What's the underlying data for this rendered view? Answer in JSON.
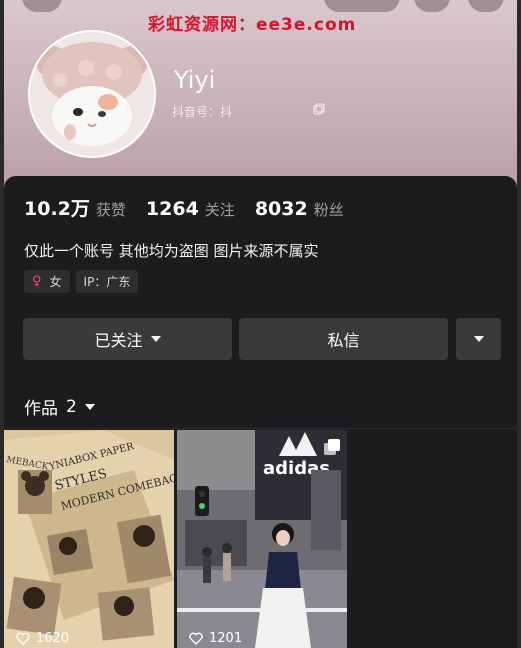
{
  "watermark": "彩虹资源网：ee3e.com",
  "profile": {
    "username": "Yiyi",
    "douyin_id_text": "抖音号：抖"
  },
  "stats": [
    {
      "value": "10.2万",
      "label": "获赞"
    },
    {
      "value": "1264",
      "label": "关注"
    },
    {
      "value": "8032",
      "label": "粉丝"
    }
  ],
  "bio": "仅此一个账号 其他均为盗图 图片来源不属实",
  "tags": {
    "gender": "女",
    "gender_symbol": "♀",
    "ip": "IP：广东"
  },
  "actions": {
    "follow": "已关注",
    "message": "私信"
  },
  "works": {
    "label": "作品",
    "count": "2"
  },
  "posts": [
    {
      "likes": "1620",
      "headline1": "YNIABOX PAPER",
      "headline2": "STYLES",
      "headline3": "MODERN COMEBACK",
      "side": "MEBACK"
    },
    {
      "likes": "1201",
      "sign": "adidas"
    }
  ],
  "colors": {
    "accent_pink": "#ff3d7f",
    "watermark_red": "#e0102a",
    "button_bg": "#3a3a3d",
    "page_bg": "#1c1c1e"
  },
  "icons": [
    "copy-icon",
    "caret-down-icon",
    "heart-icon",
    "multi-image-icon",
    "gender-female-icon"
  ]
}
